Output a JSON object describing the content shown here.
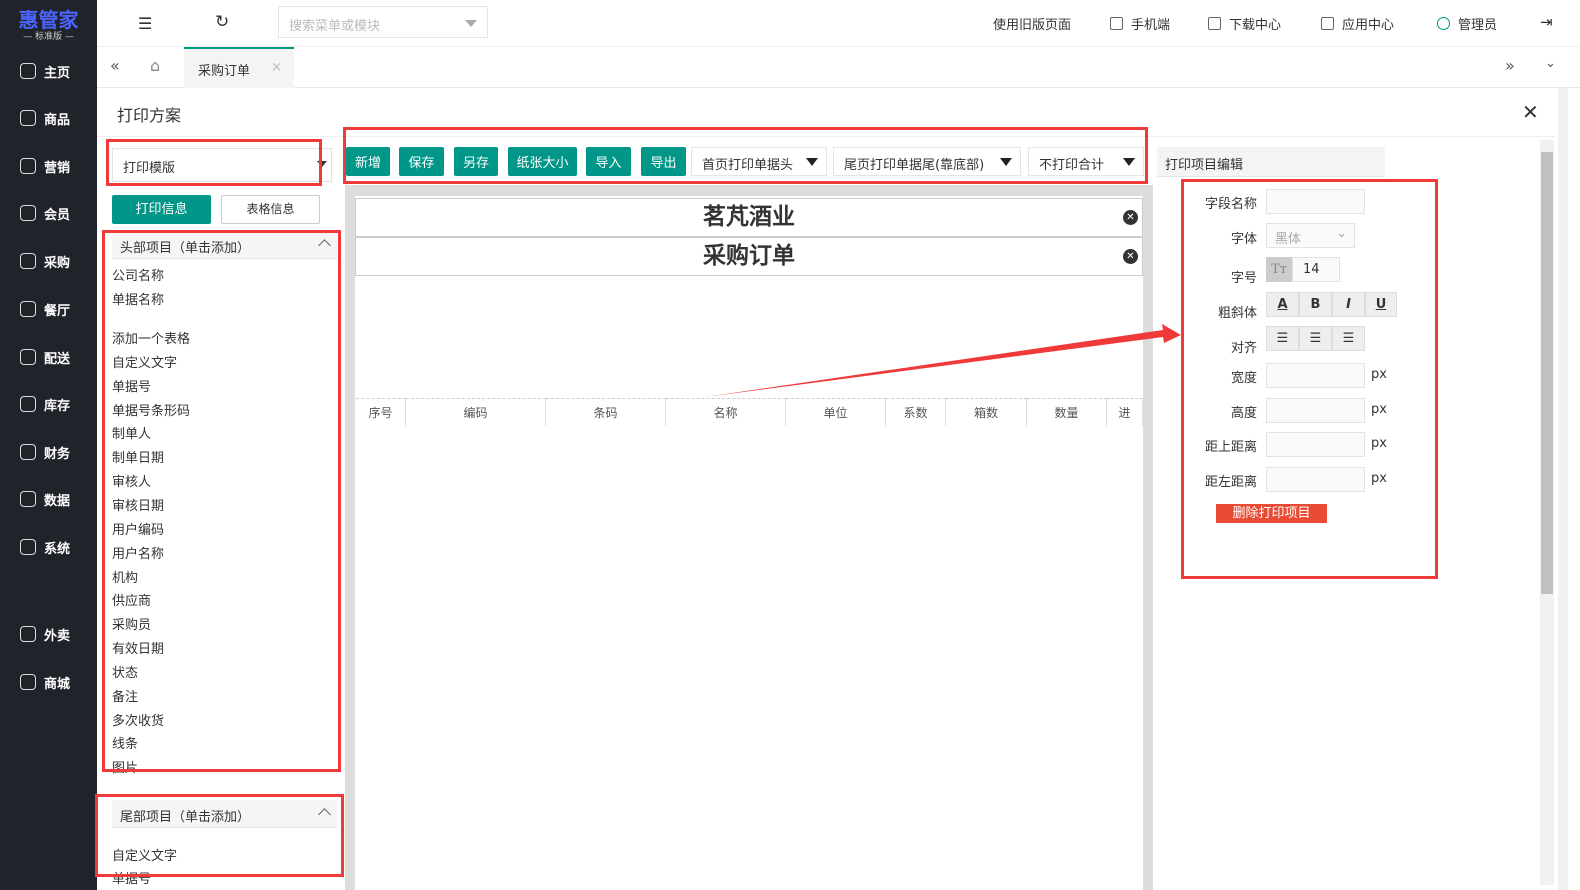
{
  "brand": {
    "name": "惠管家",
    "edition": "— 标准版 —",
    "color": "#4b63ff"
  },
  "sidebar": {
    "items": [
      {
        "label": "主页",
        "icon": "home-icon"
      },
      {
        "label": "商品",
        "icon": "box-icon"
      },
      {
        "label": "营销",
        "icon": "chart-icon"
      },
      {
        "label": "会员",
        "icon": "diamond-icon"
      },
      {
        "label": "采购",
        "icon": "list-icon"
      },
      {
        "label": "餐厅",
        "icon": "bell-icon"
      },
      {
        "label": "配送",
        "icon": "truck-icon"
      },
      {
        "label": "库存",
        "icon": "inventory-icon"
      },
      {
        "label": "财务",
        "icon": "yen-icon"
      },
      {
        "label": "数据",
        "icon": "bar-chart-icon"
      },
      {
        "label": "系统",
        "icon": "settings-icon"
      },
      {
        "label": "外卖",
        "icon": "bike-icon"
      },
      {
        "label": "商城",
        "icon": "shop-icon"
      }
    ]
  },
  "topbar": {
    "search_placeholder": "搜索菜单或模块",
    "old_version": "使用旧版页面",
    "mobile": "手机端",
    "download": "下载中心",
    "apps": "应用中心",
    "user": "管理员"
  },
  "tabs": {
    "active": "采购订单"
  },
  "panel": {
    "title": "打印方案"
  },
  "template_select": "打印模版",
  "left_tabs": {
    "print_info": "打印信息",
    "table_info": "表格信息"
  },
  "head_section": {
    "title": "头部项目（单击添加）",
    "items": [
      "公司名称",
      "单据名称",
      "添加一个表格",
      "自定义文字",
      "单据号",
      "单据号条形码",
      "制单人",
      "制单日期",
      "审核人",
      "审核日期",
      "用户编码",
      "用户名称",
      "机构",
      "供应商",
      "采购员",
      "有效日期",
      "状态",
      "备注",
      "多次收货",
      "线条",
      "图片"
    ]
  },
  "foot_section": {
    "title": "尾部项目（单击添加）",
    "items": [
      "自定义文字",
      "单据号"
    ]
  },
  "toolbar": {
    "add": "新增",
    "save": "保存",
    "save_as": "另存",
    "paper_size": "纸张大小",
    "import": "导入",
    "export": "导出",
    "header_opt": "首页打印单据头",
    "footer_opt": "尾页打印单据尾(靠底部)",
    "total_opt": "不打印合计"
  },
  "paper": {
    "company": "茗芃酒业",
    "doc_title": "采购订单",
    "columns": [
      "序号",
      "编码",
      "条码",
      "名称",
      "单位",
      "系数",
      "箱数",
      "数量",
      "进"
    ]
  },
  "editor": {
    "title": "打印项目编辑",
    "field_name": "字段名称",
    "font": "字体",
    "font_value": "黑体",
    "font_size": "字号",
    "font_size_value": "14",
    "style": "粗斜体",
    "align": "对齐",
    "width": "宽度",
    "height": "高度",
    "top": "距上距离",
    "left": "距左距离",
    "unit": "px",
    "delete": "删除打印项目",
    "style_buttons": [
      "A",
      "B",
      "I",
      "U"
    ]
  },
  "colors": {
    "accent": "#009688",
    "sidebar": "#20232a",
    "danger": "#e94b35",
    "annotation": "#f03a3a"
  }
}
